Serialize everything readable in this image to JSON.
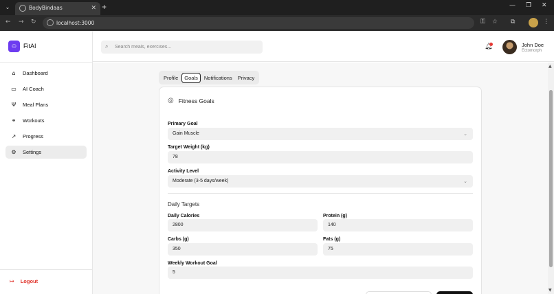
{
  "browser": {
    "tab_title": "BodyBindaas",
    "url": "localhost:3000",
    "new_tab": "+",
    "min": "—",
    "restore": "❐",
    "close": "✕",
    "tab_close": "✕",
    "tab_menu": "⌄"
  },
  "sidebar": {
    "brand": "FitAI",
    "items": [
      {
        "label": "Dashboard",
        "icon": "home-icon",
        "glyph": "⌂"
      },
      {
        "label": "AI Coach",
        "icon": "chat-icon",
        "glyph": "▭"
      },
      {
        "label": "Meal Plans",
        "icon": "utensils-icon",
        "glyph": "Ψ"
      },
      {
        "label": "Workouts",
        "icon": "dumbbell-icon",
        "glyph": "⚭"
      },
      {
        "label": "Progress",
        "icon": "trending-up-icon",
        "glyph": "↗"
      },
      {
        "label": "Settings",
        "icon": "gear-icon",
        "glyph": "⚙"
      }
    ],
    "logout": "Logout"
  },
  "header": {
    "search_placeholder": "Search meals, exercises...",
    "user_name": "John Doe",
    "user_subtitle": "Ectomorph"
  },
  "settings": {
    "tabs": [
      "Profile",
      "Goals",
      "Notifications",
      "Privacy"
    ],
    "active_tab": "Goals",
    "card_title": "Fitness Goals",
    "primary_goal_label": "Primary Goal",
    "primary_goal_value": "Gain Muscle",
    "target_weight_label": "Target Weight (kg)",
    "target_weight_value": "78",
    "activity_level_label": "Activity Level",
    "activity_level_value": "Moderate (3-5 days/week)",
    "daily_targets_title": "Daily Targets",
    "calories_label": "Daily Calories",
    "calories_value": "2800",
    "protein_label": "Protein (g)",
    "protein_value": "140",
    "carbs_label": "Carbs (g)",
    "carbs_value": "350",
    "fats_label": "Fats (g)",
    "fats_value": "75",
    "weekly_goal_label": "Weekly Workout Goal",
    "weekly_goal_value": "5"
  },
  "colors": {
    "brand": "#6d3cf0",
    "logout": "#e0332b",
    "notification_dot": "#e53935"
  }
}
